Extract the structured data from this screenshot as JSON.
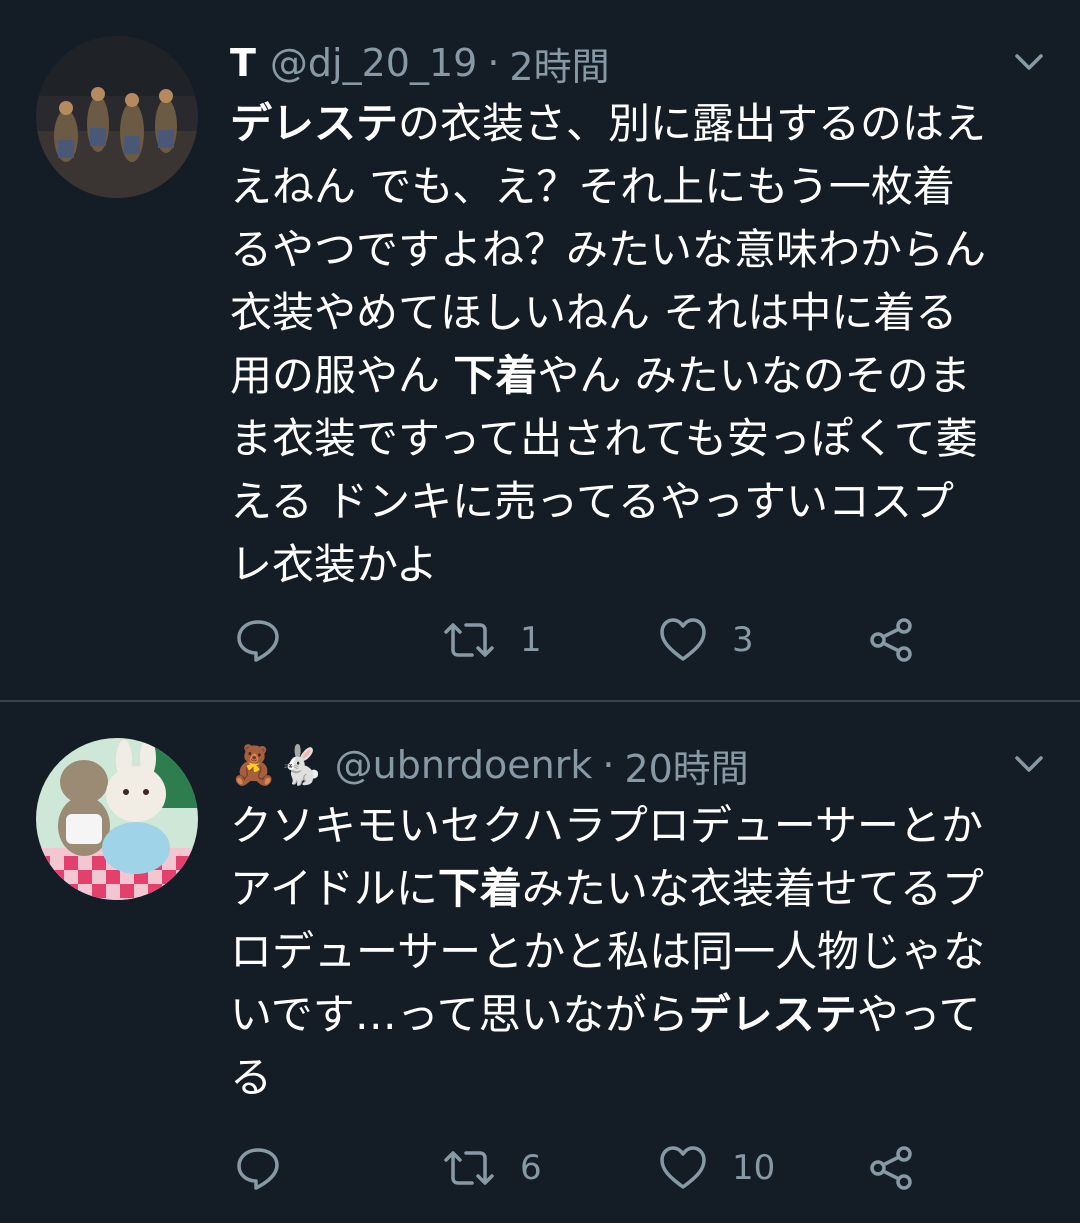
{
  "tweets": [
    {
      "display_name": "T",
      "handle": "@dj_20_19",
      "separator": "·",
      "time": "2時間",
      "avatar": "avatar-figures-image",
      "body_lines": [
        [
          {
            "text": "デレステ",
            "bold": true
          },
          {
            "text": "の衣装さ、別に露出するのはえ",
            "bold": false
          }
        ],
        [
          {
            "text": "えねん でも、え？それ上にもう一枚着",
            "bold": false
          }
        ],
        [
          {
            "text": "るやつですよね？みたいな意味わからん",
            "bold": false
          }
        ],
        [
          {
            "text": "衣装やめてほしいねん それは中に着る",
            "bold": false
          }
        ],
        [
          {
            "text": "用の服やん ",
            "bold": false
          },
          {
            "text": "下着",
            "bold": true
          },
          {
            "text": "やん みたいなのそのま",
            "bold": false
          }
        ],
        [
          {
            "text": "ま衣装ですって出されても安っぽくて萎",
            "bold": false
          }
        ],
        [
          {
            "text": "える ドンキに売ってるやっすいコスプ",
            "bold": false
          }
        ],
        [
          {
            "text": "レ衣装かよ",
            "bold": false
          }
        ]
      ],
      "actions": {
        "reply_icon": "reply-icon",
        "retweet_icon": "retweet-icon",
        "retweet_count": "1",
        "like_icon": "heart-icon",
        "like_count": "3",
        "share_icon": "share-icon"
      }
    },
    {
      "display_name": "🧸🐇",
      "handle": "@ubnrdoenrk",
      "separator": "·",
      "time": "20時間",
      "avatar": "avatar-plush-toys-image",
      "body_lines": [
        [
          {
            "text": "クソキモいセクハラプロデューサーとか",
            "bold": false
          }
        ],
        [
          {
            "text": "アイドルに",
            "bold": false
          },
          {
            "text": "下着",
            "bold": true
          },
          {
            "text": "みたいな衣装着せてるプ",
            "bold": false
          }
        ],
        [
          {
            "text": "ロデューサーとかと私は同一人物じゃな",
            "bold": false
          }
        ],
        [
          {
            "text": "いです…って思いながら",
            "bold": false
          },
          {
            "text": "デレステ",
            "bold": true
          },
          {
            "text": "やって",
            "bold": false
          }
        ],
        [
          {
            "text": "る",
            "bold": false
          }
        ]
      ],
      "actions": {
        "reply_icon": "reply-icon",
        "retweet_icon": "retweet-icon",
        "retweet_count": "6",
        "like_icon": "heart-icon",
        "like_count": "10",
        "share_icon": "share-icon"
      }
    }
  ],
  "colors": {
    "background": "#141d26",
    "text": "#ffffff",
    "secondary": "#8899a6",
    "divider": "#38444d"
  }
}
